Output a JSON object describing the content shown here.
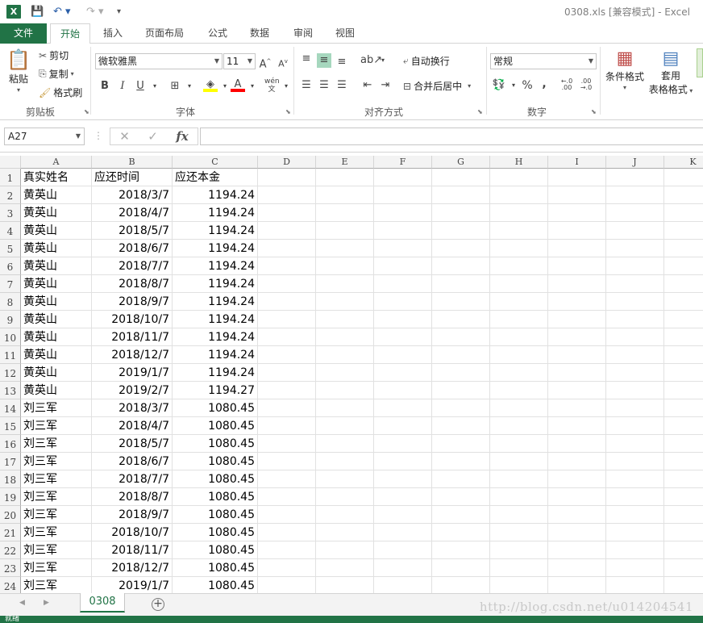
{
  "titlebar": {
    "app_icon": "X",
    "title": "0308.xls  [兼容模式] - Excel",
    "icons": [
      "save-icon",
      "undo-icon",
      "redo-icon",
      "customize-qat-icon"
    ]
  },
  "tabs": [
    "文件",
    "开始",
    "插入",
    "页面布局",
    "公式",
    "数据",
    "审阅",
    "视图"
  ],
  "ribbon": {
    "clipboard": {
      "paste": "粘贴",
      "cut": "剪切",
      "copy": "复制",
      "format_painter": "格式刷",
      "label": "剪贴板"
    },
    "font": {
      "font_name": "微软雅黑",
      "font_size": "11",
      "bold": "B",
      "italic": "I",
      "underline": "U",
      "phonetic": "wén",
      "label": "字体"
    },
    "alignment": {
      "wrap": "自动换行",
      "merge": "合并后居中",
      "label": "对齐方式"
    },
    "number": {
      "format": "常规",
      "percent": "%",
      "comma": ",",
      "label": "数字"
    },
    "styles": {
      "conditional": "条件格式",
      "table_line1": "套用",
      "table_line2": "表格格式"
    }
  },
  "formula_bar": {
    "name_box": "A27",
    "fx": "fx",
    "content": ""
  },
  "columns": [
    "A",
    "B",
    "C",
    "D",
    "E",
    "F",
    "G",
    "H",
    "I",
    "J",
    "K"
  ],
  "rows": [
    {
      "n": "1",
      "a": "真实姓名",
      "b": "应还时间",
      "c": "应还本金"
    },
    {
      "n": "2",
      "a": "黄英山",
      "b": "2018/3/7",
      "c": "1194.24"
    },
    {
      "n": "3",
      "a": "黄英山",
      "b": "2018/4/7",
      "c": "1194.24"
    },
    {
      "n": "4",
      "a": "黄英山",
      "b": "2018/5/7",
      "c": "1194.24"
    },
    {
      "n": "5",
      "a": "黄英山",
      "b": "2018/6/7",
      "c": "1194.24"
    },
    {
      "n": "6",
      "a": "黄英山",
      "b": "2018/7/7",
      "c": "1194.24"
    },
    {
      "n": "7",
      "a": "黄英山",
      "b": "2018/8/7",
      "c": "1194.24"
    },
    {
      "n": "8",
      "a": "黄英山",
      "b": "2018/9/7",
      "c": "1194.24"
    },
    {
      "n": "9",
      "a": "黄英山",
      "b": "2018/10/7",
      "c": "1194.24"
    },
    {
      "n": "10",
      "a": "黄英山",
      "b": "2018/11/7",
      "c": "1194.24"
    },
    {
      "n": "11",
      "a": "黄英山",
      "b": "2018/12/7",
      "c": "1194.24"
    },
    {
      "n": "12",
      "a": "黄英山",
      "b": "2019/1/7",
      "c": "1194.24"
    },
    {
      "n": "13",
      "a": "黄英山",
      "b": "2019/2/7",
      "c": "1194.27"
    },
    {
      "n": "14",
      "a": "刘三军",
      "b": "2018/3/7",
      "c": "1080.45"
    },
    {
      "n": "15",
      "a": "刘三军",
      "b": "2018/4/7",
      "c": "1080.45"
    },
    {
      "n": "16",
      "a": "刘三军",
      "b": "2018/5/7",
      "c": "1080.45"
    },
    {
      "n": "17",
      "a": "刘三军",
      "b": "2018/6/7",
      "c": "1080.45"
    },
    {
      "n": "18",
      "a": "刘三军",
      "b": "2018/7/7",
      "c": "1080.45"
    },
    {
      "n": "19",
      "a": "刘三军",
      "b": "2018/8/7",
      "c": "1080.45"
    },
    {
      "n": "20",
      "a": "刘三军",
      "b": "2018/9/7",
      "c": "1080.45"
    },
    {
      "n": "21",
      "a": "刘三军",
      "b": "2018/10/7",
      "c": "1080.45"
    },
    {
      "n": "22",
      "a": "刘三军",
      "b": "2018/11/7",
      "c": "1080.45"
    },
    {
      "n": "23",
      "a": "刘三军",
      "b": "2018/12/7",
      "c": "1080.45"
    },
    {
      "n": "24",
      "a": "刘三军",
      "b": "2019/1/7",
      "c": "1080.45"
    }
  ],
  "sheet": {
    "active_tab": "0308",
    "add": "+"
  },
  "watermark": "http://blog.csdn.net/u014204541",
  "status": "就绪",
  "colors": {
    "accent": "#217346",
    "selected": "#a6d7be"
  }
}
